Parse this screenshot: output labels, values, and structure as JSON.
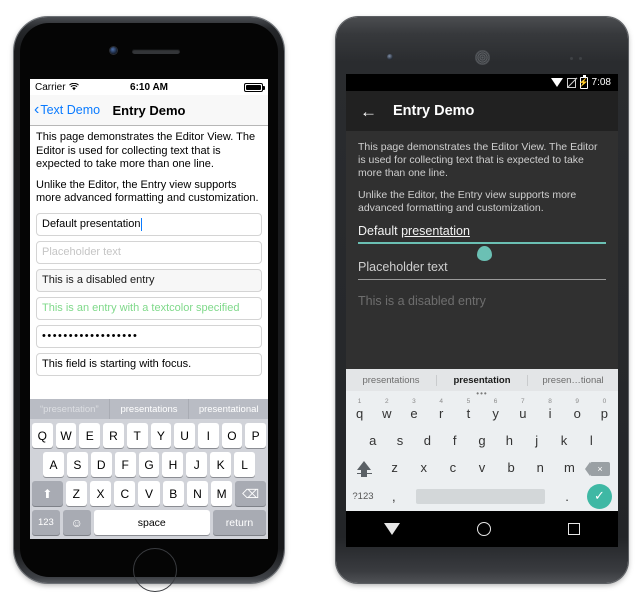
{
  "ios": {
    "status": {
      "carrier": "Carrier",
      "wifi_icon": "wifi-icon",
      "time": "6:10 AM",
      "battery_icon": "battery-icon"
    },
    "nav": {
      "back_label": "Text Demo",
      "back_chevron": "chevron-left-icon",
      "title": "Entry Demo"
    },
    "paragraphs": [
      "This page demonstrates the Editor View. The Editor is used for collecting text that is expected to take more than one line.",
      "Unlike the Editor, the Entry view supports more advanced formatting and customization."
    ],
    "fields": [
      {
        "value": "Default presentation",
        "kind": "focused"
      },
      {
        "value": "Placeholder text",
        "kind": "placeholder"
      },
      {
        "value": "This is a disabled entry",
        "kind": "disabled"
      },
      {
        "value": "This is an entry with a textcolor specified",
        "kind": "green"
      },
      {
        "value": "••••••••••••••••••",
        "kind": "password"
      },
      {
        "value": "This field is starting with focus.",
        "kind": "normal"
      }
    ],
    "keyboard": {
      "suggestions": [
        "“presentation”",
        "presentations",
        "presentational"
      ],
      "row1": [
        "Q",
        "W",
        "E",
        "R",
        "T",
        "Y",
        "U",
        "I",
        "O",
        "P"
      ],
      "row2": [
        "A",
        "S",
        "D",
        "F",
        "G",
        "H",
        "J",
        "K",
        "L"
      ],
      "row3": [
        "Z",
        "X",
        "C",
        "V",
        "B",
        "N",
        "M"
      ],
      "shift_icon": "shift-icon",
      "backspace_icon": "backspace-icon",
      "numbers_key": "123",
      "emoji_icon": "emoji-icon",
      "space_key": "space",
      "return_key": "return"
    }
  },
  "android": {
    "status": {
      "wifi_icon": "wifi-icon",
      "signal_icon": "signal-icon",
      "battery_icon": "battery-charging-icon",
      "time": "7:08"
    },
    "appbar": {
      "back_icon": "arrow-left-icon",
      "title": "Entry Demo"
    },
    "paragraphs": [
      "This page demonstrates the Editor View. The Editor is used for collecting text that is expected to take more than one line.",
      "Unlike the Editor, the Entry view supports more advanced formatting and customization."
    ],
    "fields": [
      {
        "value_prefix": "Default ",
        "value_underlined": "presentation",
        "kind": "focused"
      },
      {
        "value": "Placeholder text",
        "kind": "placeholder"
      },
      {
        "value": "This is a disabled entry",
        "kind": "disabled"
      }
    ],
    "selection_handle": "text-selection-handle",
    "accent_color": "#6bc0b4",
    "keyboard": {
      "suggestions": [
        "presentations",
        "presentation",
        "presen…tional"
      ],
      "more_dots": "•••",
      "row1": [
        {
          "key": "q",
          "num": "1"
        },
        {
          "key": "w",
          "num": "2"
        },
        {
          "key": "e",
          "num": "3"
        },
        {
          "key": "r",
          "num": "4"
        },
        {
          "key": "t",
          "num": "5"
        },
        {
          "key": "y",
          "num": "6"
        },
        {
          "key": "u",
          "num": "7"
        },
        {
          "key": "i",
          "num": "8"
        },
        {
          "key": "o",
          "num": "9"
        },
        {
          "key": "p",
          "num": "0"
        }
      ],
      "row2": [
        "a",
        "s",
        "d",
        "f",
        "g",
        "h",
        "j",
        "k",
        "l"
      ],
      "row3": [
        "z",
        "x",
        "c",
        "v",
        "b",
        "n",
        "m"
      ],
      "shift_icon": "shift-icon",
      "backspace_icon": "backspace-icon",
      "symbols_key": "?123",
      "comma_key": ",",
      "period_key": ".",
      "enter_icon": "check-icon"
    },
    "navbar": {
      "back_icon": "nav-back-icon",
      "home_icon": "nav-home-icon",
      "recents_icon": "nav-recents-icon"
    }
  }
}
